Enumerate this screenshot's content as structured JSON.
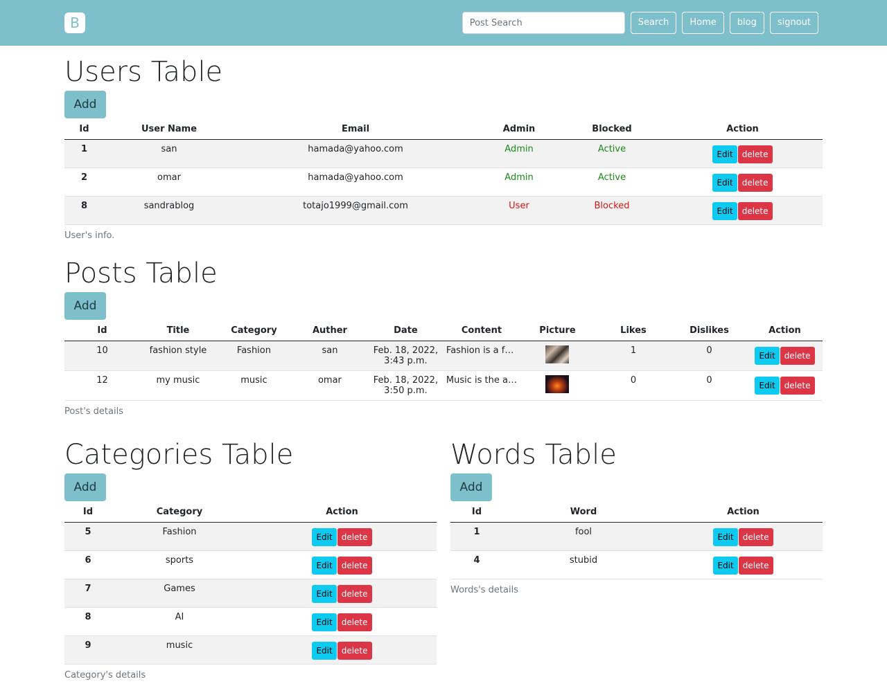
{
  "navbar": {
    "brand": "B",
    "search_placeholder": "Post Search",
    "search_label": "Search",
    "home_label": "Home",
    "blog_label": "blog",
    "signout_label": "signout"
  },
  "users": {
    "title": "Users Table",
    "add_label": "Add",
    "headers": [
      "Id",
      "User Name",
      "Email",
      "Admin",
      "Blocked",
      "Action"
    ],
    "rows": [
      {
        "id": "1",
        "name": "san",
        "email": "hamada@yahoo.com",
        "admin": "Admin",
        "blocked": "Active"
      },
      {
        "id": "2",
        "name": "omar",
        "email": "hamada@yahoo.com",
        "admin": "Admin",
        "blocked": "Active"
      },
      {
        "id": "8",
        "name": "sandrablog",
        "email": "totajo1999@gmail.com",
        "admin": "User",
        "blocked": "Blocked"
      }
    ],
    "caption": "User's info."
  },
  "posts": {
    "title": "Posts Table",
    "add_label": "Add",
    "headers": [
      "Id",
      "Title",
      "Category",
      "Auther",
      "Date",
      "Content",
      "Picture",
      "Likes",
      "Dislikes",
      "Action"
    ],
    "rows": [
      {
        "id": "10",
        "title": "fashion style",
        "category": "Fashion",
        "auther": "san",
        "date_line1": "Feb. 18, 2022,",
        "date_line2": "3:43 p.m.",
        "content": "Fashion is a f…",
        "likes": "1",
        "dislikes": "0"
      },
      {
        "id": "12",
        "title": "my music",
        "category": "music",
        "auther": "omar",
        "date_line1": "Feb. 18, 2022,",
        "date_line2": "3:50 p.m.",
        "content": "Music is the a…",
        "likes": "0",
        "dislikes": "0"
      }
    ],
    "caption": "Post's details"
  },
  "categories": {
    "title": "Categories Table",
    "add_label": "Add",
    "headers": [
      "Id",
      "Category",
      "Action"
    ],
    "rows": [
      {
        "id": "5",
        "name": "Fashion"
      },
      {
        "id": "6",
        "name": "sports"
      },
      {
        "id": "7",
        "name": "Games"
      },
      {
        "id": "8",
        "name": "AI"
      },
      {
        "id": "9",
        "name": "music"
      }
    ],
    "caption": "Category's details"
  },
  "words": {
    "title": "Words Table",
    "add_label": "Add",
    "headers": [
      "Id",
      "Word",
      "Action"
    ],
    "rows": [
      {
        "id": "1",
        "word": "fool"
      },
      {
        "id": "4",
        "word": "stubid"
      }
    ],
    "caption": "Words's details"
  },
  "actions": {
    "edit_label": "Edit",
    "delete_label": "delete"
  },
  "colors": {
    "navbar": "#7dbfcb",
    "edit_button": "#0dcaf0",
    "delete_button": "#dc3545",
    "status_green": "#1a8a1a",
    "status_red": "#dc1414"
  }
}
